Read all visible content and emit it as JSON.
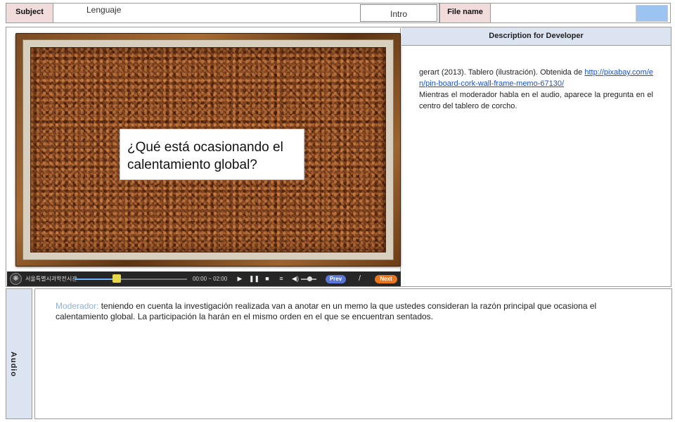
{
  "header": {
    "subject_label": "Subject",
    "subject_value": "Lenguaje",
    "intro_label": "Intro",
    "filename_label": "File name",
    "filename_value": "",
    "filename_swatch_color": "#9dc3f1"
  },
  "stage": {
    "question": "¿Qué está ocasionando el calentamiento global?",
    "player": {
      "brand": "서울특별시과학전시관",
      "time": "00:00 ~ 02:00",
      "progress_fraction": 0.34,
      "volume_fraction": 0.5,
      "prev_label": "Prev",
      "separator": "/",
      "next_label": "Next",
      "icons": [
        "logo-icon",
        "play-icon",
        "pause-icon",
        "stop-icon",
        "list-icon",
        "volume-icon"
      ]
    }
  },
  "description": {
    "title": "Description for Developer",
    "citation_text": "gerart (2013). Tablero (ilustración). Obtenida de ",
    "citation_link": "http://pixabay.com/en/pin-board-cork-wall-frame-memo-67130/",
    "note": " Mientras el moderador habla en el audio, aparece la pregunta en el centro del tablero de corcho."
  },
  "audio": {
    "label": "Audio",
    "speaker": "Moderador:",
    "text": " teniendo en cuenta la investigación realizada van a anotar en un memo la que ustedes consideran la razón principal que ocasiona el calentamiento global. La participación la harán en el  mismo orden en el que se encuentran sentados."
  },
  "colors": {
    "header_label_bg": "#f2dcdb",
    "panel_header_bg": "#dbe4f0",
    "speaker_color": "#8fb1da",
    "prev_button": "#5a76d8",
    "next_button": "#e87722"
  }
}
